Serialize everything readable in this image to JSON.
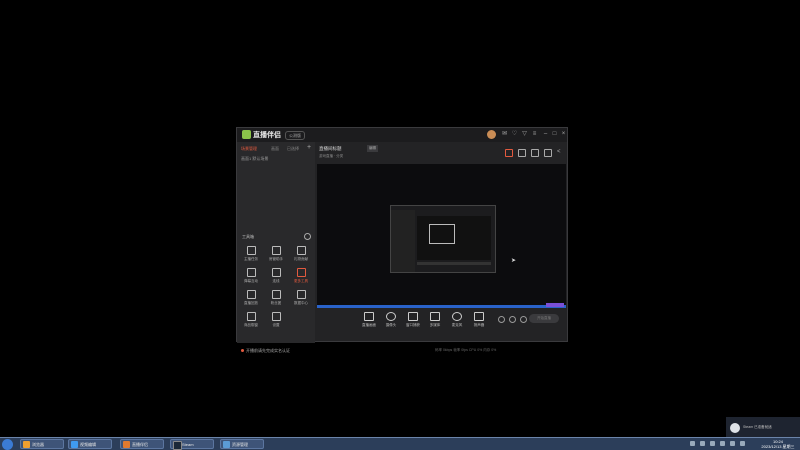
{
  "app": {
    "title": "直播伴侣",
    "version_badge": "公测版"
  },
  "left_panel": {
    "tabs": [
      "场景管理",
      "画面",
      "已选择"
    ],
    "scene_item": "画面1 默认场景",
    "tools_title": "工具箱",
    "tools": [
      {
        "label": "主播任务",
        "icon": "task-icon"
      },
      {
        "label": "房管助手",
        "icon": "admin-icon"
      },
      {
        "label": "礼物贡献",
        "icon": "gift-icon"
      },
      {
        "label": "弹幕互动",
        "icon": "chat-icon"
      },
      {
        "label": "连线",
        "icon": "link-icon"
      },
      {
        "label": "更多工具",
        "icon": "more-icon"
      },
      {
        "label": "直播回放",
        "icon": "replay-icon"
      },
      {
        "label": "粉丝团",
        "icon": "fans-icon"
      },
      {
        "label": "数据中心",
        "icon": "data-icon"
      },
      {
        "label": "商品橱窗",
        "icon": "shop-icon"
      },
      {
        "label": "设置",
        "icon": "settings-icon"
      }
    ],
    "bottom_note": "开播前请先完成实名认证"
  },
  "room": {
    "title": "直播间标题",
    "tag": "编辑",
    "subtitle": "游戏直播 · 分类"
  },
  "controls": [
    {
      "label": "直播画面",
      "icon": "screen-icon"
    },
    {
      "label": "摄像头",
      "icon": "camera-icon"
    },
    {
      "label": "窗口捕获",
      "icon": "window-icon"
    },
    {
      "label": "多媒体",
      "icon": "media-icon"
    },
    {
      "label": "麦克风",
      "icon": "mic-icon"
    },
    {
      "label": "扬声器",
      "icon": "speaker-icon"
    }
  ],
  "golive_label": "开始直播",
  "statusbar": "码率 0kbps   帧率 0fps   CPU 0%   内存 0%",
  "steam_popup": "Steam 已准备就绪",
  "taskbar": {
    "items": [
      {
        "label": "浏览器",
        "color": "#f0a030"
      },
      {
        "label": "视频编辑",
        "color": "#3f9af0"
      },
      {
        "label": "直播伴侣",
        "color": "#e07a30"
      },
      {
        "label": "Steam",
        "color": "#1b2838"
      },
      {
        "label": "资源管理",
        "color": "#5b9bd5"
      }
    ],
    "time": "10:24",
    "date": "2023/12/13 星期三"
  },
  "colors": {
    "accent": "#e35a3f",
    "background": "#000000",
    "panel": "#232325"
  }
}
